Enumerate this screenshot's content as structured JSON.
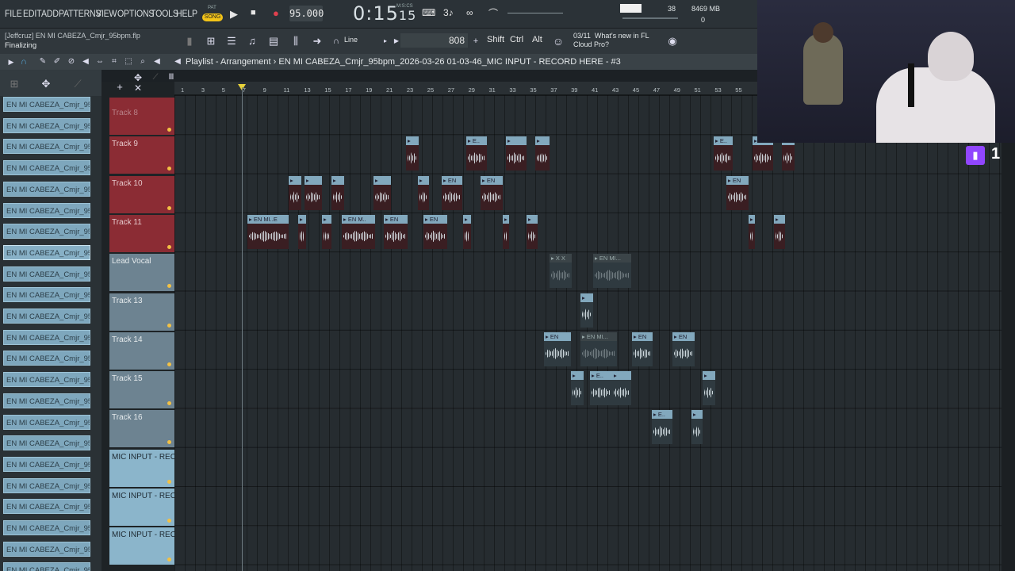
{
  "menu": [
    "FILE",
    "EDIT",
    "ADD",
    "PATTERNS",
    "VIEW",
    "OPTIONS",
    "TOOLS",
    "HELP"
  ],
  "transport": {
    "pat": "PAT",
    "song": "SONG",
    "tempo": "95.000",
    "time": "0:15",
    "time_small": "15",
    "msc": "M:S:CS"
  },
  "cpu": {
    "mem": "8469 MB",
    "voices": "38",
    "zero": "0"
  },
  "file": {
    "name": "[Jeffcruz] EN MI CABEZA_Cmjr_95bpm.flp",
    "status": "Finalizing"
  },
  "toolbar": {
    "line": "Line",
    "num": "808",
    "shift": "Shift",
    "ctrl": "Ctrl",
    "alt": "Alt",
    "news_date": "03/11",
    "news_text": "What's new in FL",
    "news_text2": "Cloud Pro?"
  },
  "playlist": {
    "title": "Playlist - Arrangement",
    "path": "EN MI CABEZA_Cmjr_95bpm_2026-03-26 01-03-46_MIC INPUT - RECORD HERE - #3"
  },
  "browser_item": "EN MI CABEZA_Cmjr_95bp...",
  "tracks": [
    {
      "name": "Track 8"
    },
    {
      "name": "Track 9"
    },
    {
      "name": "Track 10"
    },
    {
      "name": "Track 11"
    },
    {
      "name": "Lead Vocal"
    },
    {
      "name": "Track 13"
    },
    {
      "name": "Track 14"
    },
    {
      "name": "Track 15"
    },
    {
      "name": "Track 16"
    },
    {
      "name": "MIC INPUT - REC"
    },
    {
      "name": "MIC INPUT - RECORD HERE -"
    },
    {
      "name": "MIC INPUT - RECORD HERE -"
    }
  ],
  "ruler": [
    "1",
    "3",
    "5",
    "7",
    "9",
    "11",
    "13",
    "15",
    "17",
    "19",
    "21",
    "23",
    "25",
    "27",
    "29",
    "31",
    "33",
    "35",
    "37",
    "39",
    "41",
    "43",
    "45",
    "47",
    "49",
    "51",
    "53",
    "55"
  ],
  "clip_labels": {
    "en": "EN",
    "enmi": "EN MI...",
    "enmie": "EN MI..E",
    "enm": "EN M..",
    "e": "E..",
    "x": "X X"
  },
  "twitch": {
    "count": "1"
  }
}
